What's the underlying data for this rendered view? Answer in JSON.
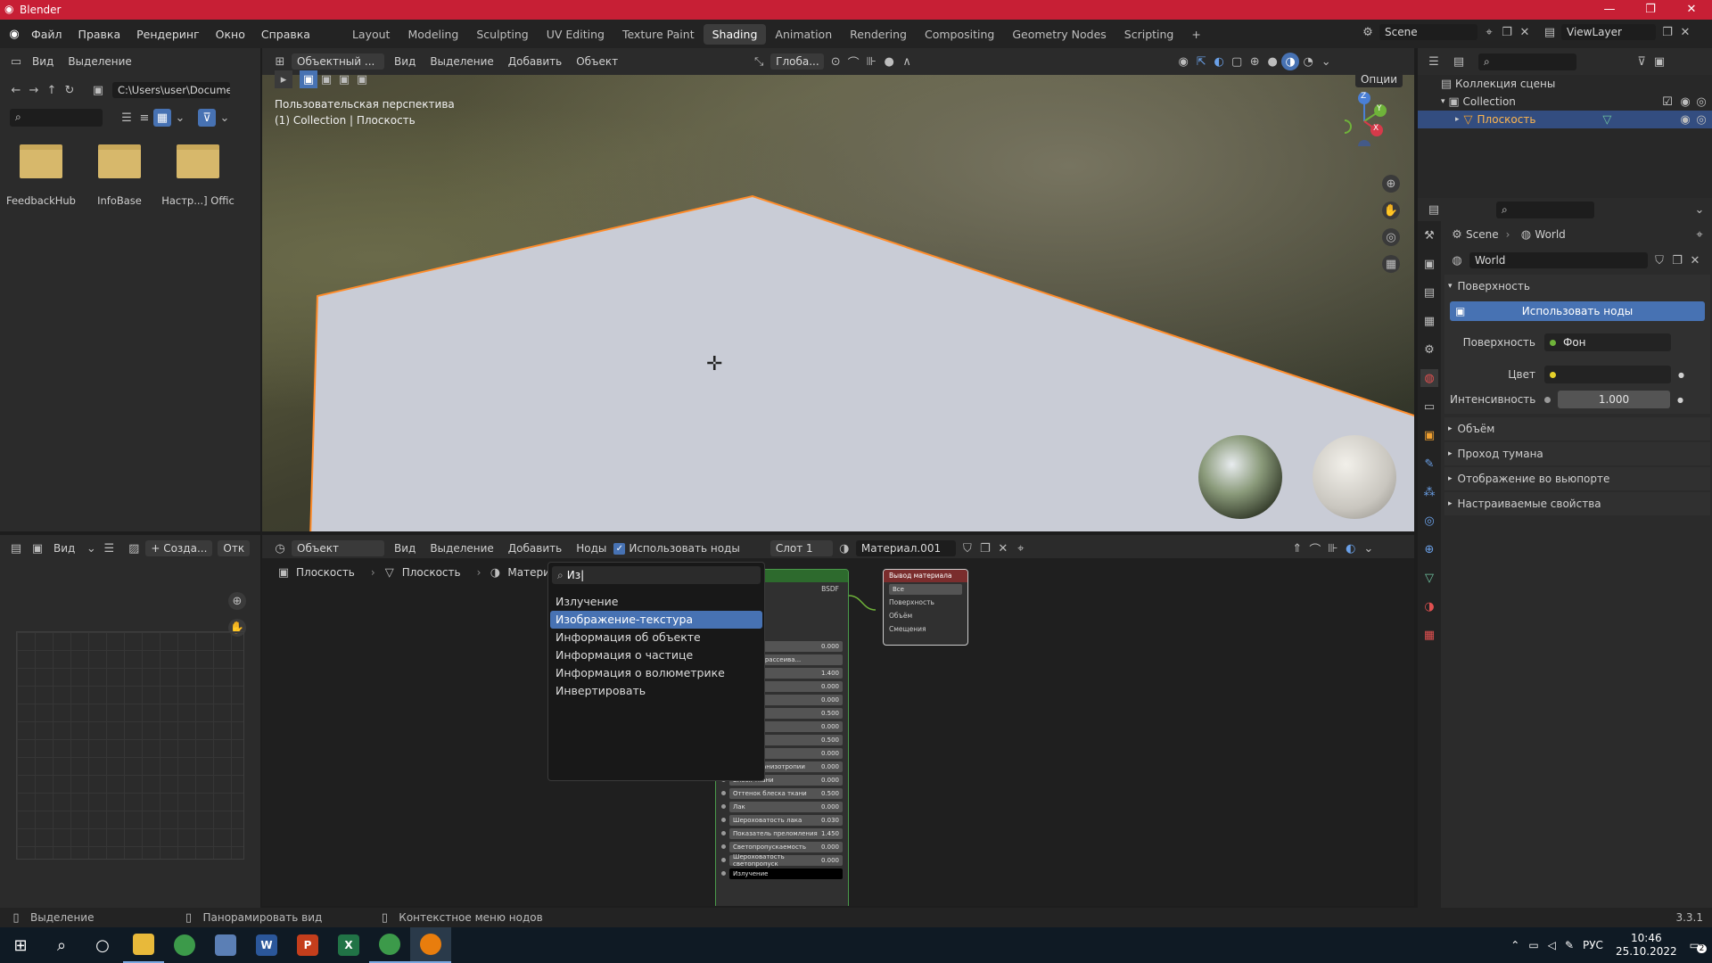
{
  "window": {
    "title": "Blender",
    "controls": [
      "—",
      "❐",
      "✕"
    ]
  },
  "menu": [
    "Файл",
    "Правка",
    "Рендеринг",
    "Окно",
    "Справка"
  ],
  "workspaces": [
    "Layout",
    "Modeling",
    "Sculpting",
    "UV Editing",
    "Texture Paint",
    "Shading",
    "Animation",
    "Rendering",
    "Compositing",
    "Geometry Nodes",
    "Scripting"
  ],
  "active_workspace": "Shading",
  "scene": "Scene",
  "view_layer": "ViewLayer",
  "file_browser": {
    "header": [
      "Вид",
      "Выделение"
    ],
    "path": "C:\\Users\\user\\Docume...",
    "folders": [
      "FeedbackHub",
      "InfoBase",
      "Настр...] Offic"
    ]
  },
  "viewport": {
    "mode": "Объектный ...",
    "menu": [
      "Вид",
      "Выделение",
      "Добавить",
      "Объект"
    ],
    "transform": "Глоба...",
    "options": "Опции",
    "perspective": "Пользовательская перспектива",
    "collection_info": "(1) Collection | Плоскость",
    "gizmo": {
      "z": "Z",
      "y": "Y",
      "x": "X"
    }
  },
  "outliner": {
    "root": "Коллекция сцены",
    "collection": "Collection",
    "object": "Плоскость"
  },
  "properties": {
    "breadcrumb": [
      "Scene",
      "World"
    ],
    "world_name": "World",
    "surface_section": "Поверхность",
    "use_nodes_button": "Использовать ноды",
    "surface_label": "Поверхность",
    "surface_value": "Фон",
    "color_label": "Цвет",
    "intensity_label": "Интенсивность",
    "intensity_value": "1.000",
    "sections": [
      "Объём",
      "Проход тумана",
      "Отображение во вьюпорте",
      "Настраиваемые свойства"
    ]
  },
  "image_editor": {
    "view": "Вид",
    "new": "+ Созда...",
    "open": "Отк"
  },
  "node_editor": {
    "object_mode": "Объект",
    "menu": [
      "Вид",
      "Выделение",
      "Добавить",
      "Ноды"
    ],
    "use_nodes": "Использовать ноды",
    "slot": "Слот 1",
    "material": "Материал.001",
    "breadcrumb": [
      "Плоскость",
      "Плоскость",
      "Материал"
    ]
  },
  "search_popup": {
    "query": "Из",
    "items": [
      "Излучение",
      "Изображение-текстура",
      "Информация об объекте",
      "Информация о частице",
      "Информация о волюметрике",
      "Инвертировать"
    ],
    "selected_index": 1
  },
  "bsdf_node": {
    "title": "й BSDF",
    "output": "BSDF",
    "rows": [
      {
        "label": "вание",
        "value": "0.000"
      },
      {
        "label": "ностного рассеива...",
        "value": ""
      },
      {
        "label": "",
        "value": "1.400"
      },
      {
        "label": "ртопу",
        "value": "0.000"
      },
      {
        "label": "",
        "value": "0.000"
      },
      {
        "label": "",
        "value": "0.500"
      },
      {
        "label": "",
        "value": "0.000"
      },
      {
        "label": "",
        "value": "0.500"
      },
      {
        "label": "ь",
        "value": "0.000"
      },
      {
        "label": "Поворот анизотропии",
        "value": "0.000"
      },
      {
        "label": "Блеск ткани",
        "value": "0.000"
      },
      {
        "label": "Оттенок блеска ткани",
        "value": "0.500"
      },
      {
        "label": "Лак",
        "value": "0.000"
      },
      {
        "label": "Шероховатость лака",
        "value": "0.030"
      },
      {
        "label": "Показатель преломления",
        "value": "1.450"
      },
      {
        "label": "Светопропускаемость",
        "value": "0.000"
      },
      {
        "label": "Шероховатость светопропуск",
        "value": "0.000"
      },
      {
        "label": "Излучение",
        "value": ""
      }
    ]
  },
  "output_node": {
    "title": "Вывод материала",
    "target": "Все",
    "sockets": [
      "Поверхность",
      "Объём",
      "Смещения"
    ]
  },
  "status": {
    "select": "Выделение",
    "pan": "Панорамировать вид",
    "context": "Контекстное меню нодов",
    "version": "3.3.1"
  },
  "taskbar": {
    "lang": "РУС",
    "time": "10:46",
    "date": "25.10.2022",
    "notifications": "2"
  },
  "colors": {
    "accent": "#4772b3",
    "title_bar": "#c71f35",
    "selection_outline": "#ff8c2a"
  }
}
